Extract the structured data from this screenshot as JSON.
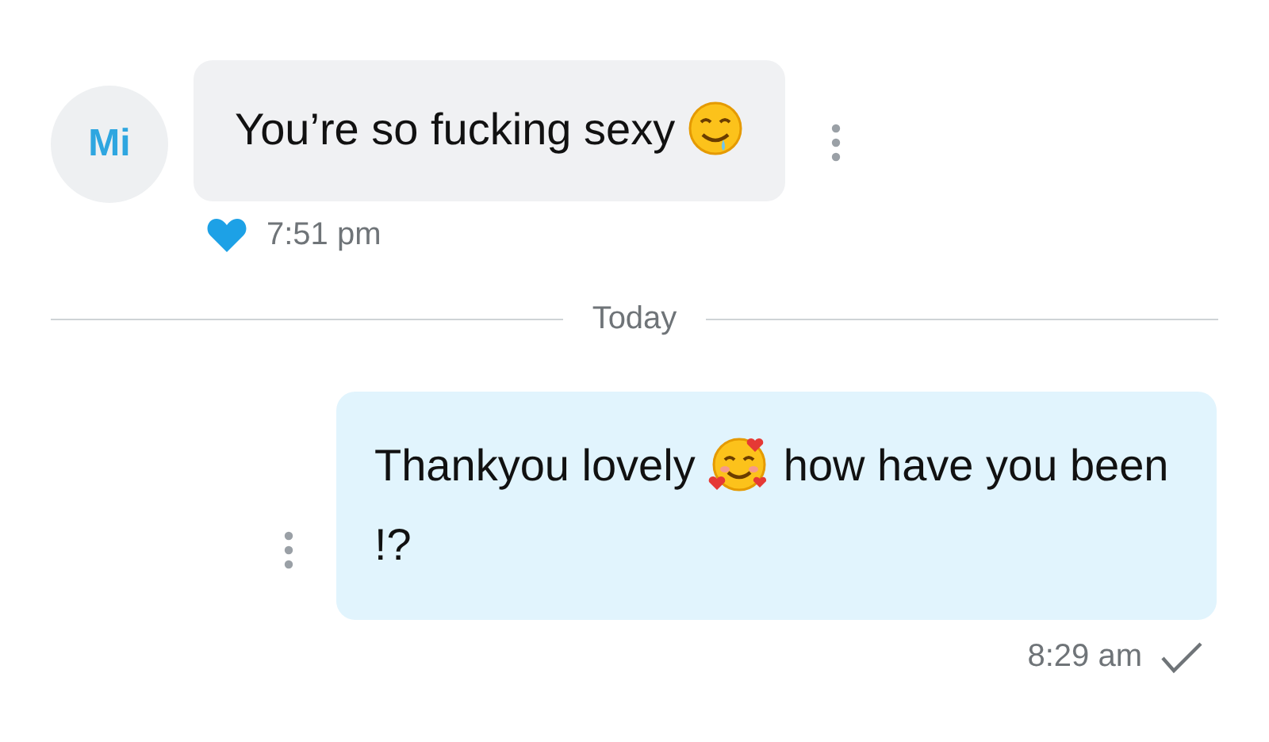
{
  "messages": [
    {
      "kind": "incoming",
      "avatar": "Mi",
      "parts": [
        {
          "kind": "text",
          "text": "You’re so fucking sexy"
        },
        {
          "kind": "emoji"
        }
      ],
      "liked": true,
      "time": "7:51 pm"
    },
    {
      "kind": "divider",
      "label": "Today"
    },
    {
      "kind": "outgoing",
      "parts": [
        {
          "kind": "text",
          "text": "Thankyou lovely"
        },
        {
          "kind": "emoji"
        },
        {
          "kind": "text",
          "text": "how have you been !?"
        }
      ],
      "read": true,
      "time": "8:29 am"
    }
  ]
}
